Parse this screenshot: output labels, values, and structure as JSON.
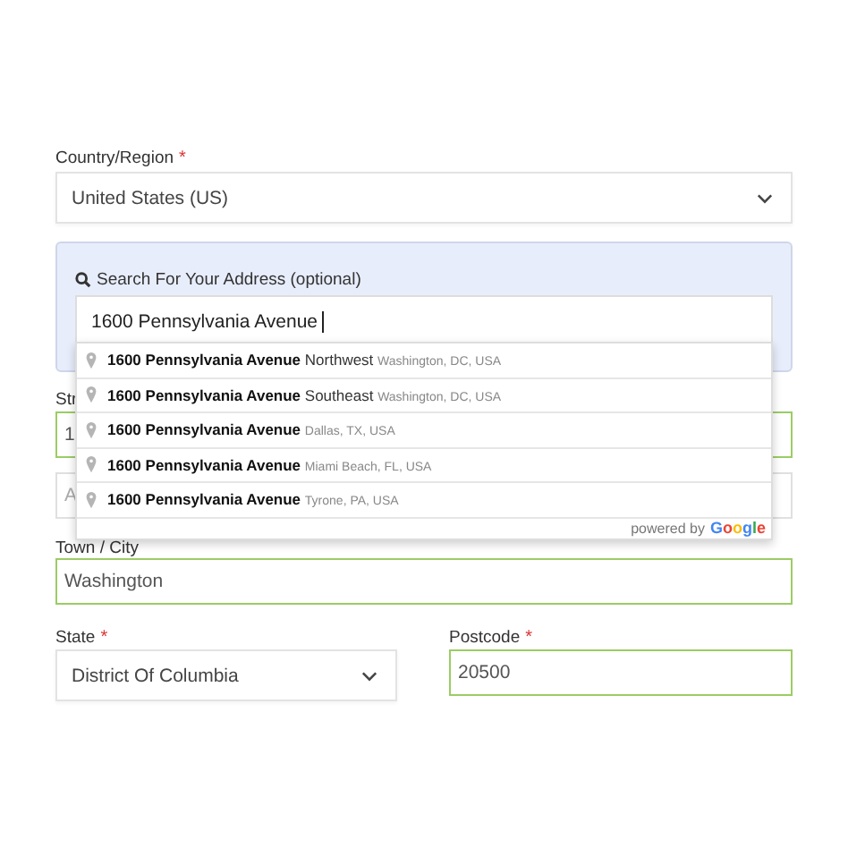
{
  "country": {
    "label": "Country/Region",
    "required_mark": "*",
    "value": "United States (US)"
  },
  "address_search": {
    "label": "Search For Your Address (optional)",
    "value": "1600 Pennsylvania Avenue",
    "suggestions": [
      {
        "main": "1600 Pennsylvania Avenue",
        "extra": "Northwest",
        "secondary": "Washington, DC, USA"
      },
      {
        "main": "1600 Pennsylvania Avenue",
        "extra": "Southeast",
        "secondary": "Washington, DC, USA"
      },
      {
        "main": "1600 Pennsylvania Avenue",
        "secondary": "Dallas, TX, USA"
      },
      {
        "main": "1600 Pennsylvania Avenue",
        "secondary": "Miami Beach, FL, USA"
      },
      {
        "main": "1600 Pennsylvania Avenue",
        "secondary": "Tyrone, PA, USA"
      }
    ],
    "attribution": {
      "prefix": "powered by",
      "brand": "Google"
    }
  },
  "street": {
    "label": "Str",
    "value": "1",
    "valid": true
  },
  "apartment": {
    "placeholder": "A",
    "valid": false
  },
  "town": {
    "label": "Town / City",
    "value": "Washington",
    "valid": true
  },
  "state": {
    "label": "State",
    "required_mark": "*",
    "value": "District Of Columbia"
  },
  "postcode": {
    "label": "Postcode",
    "required_mark": "*",
    "value": "20500",
    "valid": true
  }
}
